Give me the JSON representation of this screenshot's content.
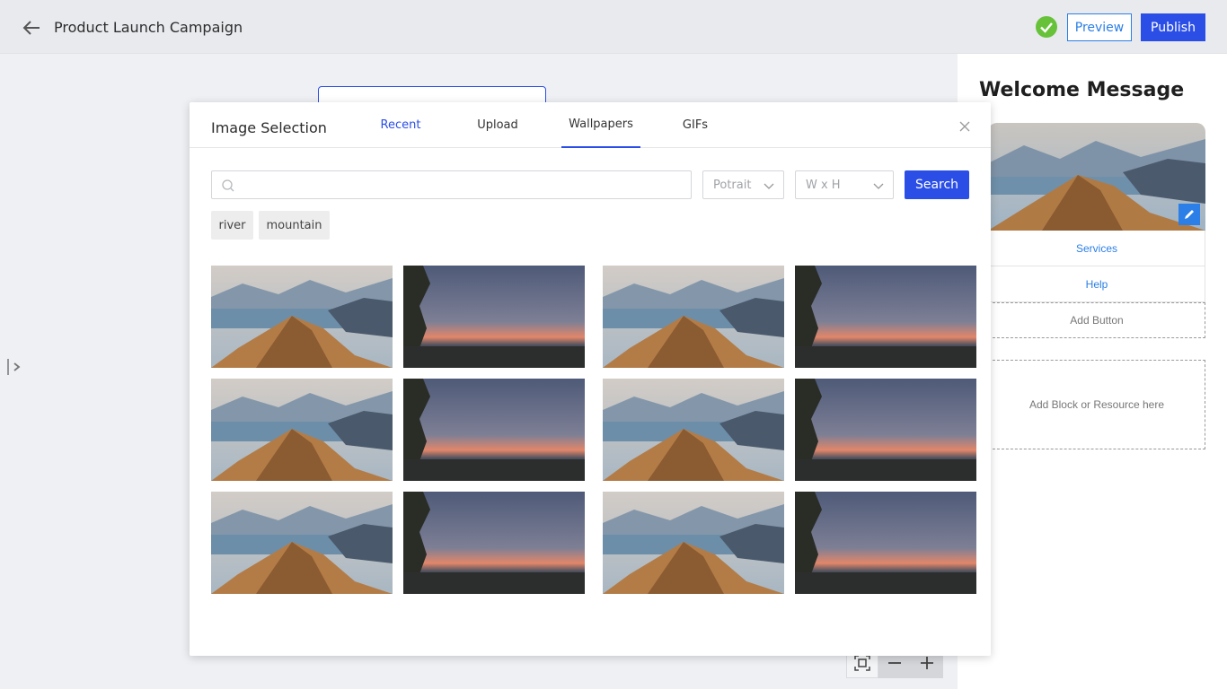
{
  "header": {
    "title": "Product Launch Campaign",
    "preview_label": "Preview",
    "publish_label": "Publish",
    "status_color": "#67c23a",
    "accent": "#2a4ee6"
  },
  "sidebar": {
    "title": "Welcome Message",
    "links": [
      "Services",
      "Help"
    ],
    "add_button_label": "Add Button",
    "add_block_label": "Add Block or Resource here"
  },
  "modal": {
    "title": "Image Selection",
    "tabs": [
      {
        "label": "Recent",
        "active": false
      },
      {
        "label": "Upload",
        "active": false
      },
      {
        "label": "Wallpapers",
        "active": true
      },
      {
        "label": "GIFs",
        "active": false
      }
    ],
    "search": {
      "value": "",
      "placeholder": ""
    },
    "orientation_select": "Potrait",
    "size_select": "W x H",
    "search_button": "Search",
    "tags": [
      "river",
      "mountain"
    ],
    "images": [
      "mountain-lake",
      "sunset-lake",
      "mountain-lake",
      "sunset-lake",
      "mountain-lake",
      "sunset-lake",
      "mountain-lake",
      "sunset-lake",
      "mountain-lake",
      "sunset-lake",
      "mountain-lake",
      "sunset-lake"
    ]
  },
  "icons": [
    "back-arrow-icon",
    "check-icon",
    "close-icon",
    "search-icon",
    "chevron-down-icon",
    "edit-pencil-icon",
    "panel-toggle-icon",
    "fit-screen-icon",
    "minus-icon",
    "plus-icon"
  ]
}
